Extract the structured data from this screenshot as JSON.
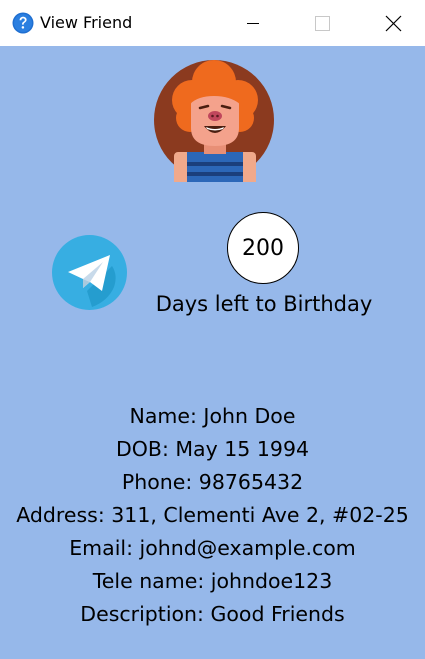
{
  "window": {
    "title": "View Friend",
    "buttons": [
      "minimize",
      "maximize",
      "close"
    ]
  },
  "icons": {
    "title": "help-question-icon",
    "avatar": "cartoon-avatar-icon",
    "telegram": "telegram-paper-plane-icon"
  },
  "colors": {
    "content_background": "#96b8ea",
    "title_icon": "#1f6fd1",
    "telegram": "#37aee2",
    "avatar_hair": "#ef6a1e",
    "avatar_background": "#8b3a1f",
    "avatar_shirt": "#2c67b8"
  },
  "birthday": {
    "days_left": "200",
    "label": "Days left to Birthday"
  },
  "friend": {
    "name_line": "Name: John Doe",
    "dob_line": "DOB: May 15 1994",
    "phone_line": "Phone: 98765432",
    "address_line": "Address: 311, Clementi Ave 2, #02-25",
    "email_line": "Email: johnd@example.com",
    "tele_line": "Tele name: johndoe123",
    "description_line": "Description: Good Friends"
  }
}
